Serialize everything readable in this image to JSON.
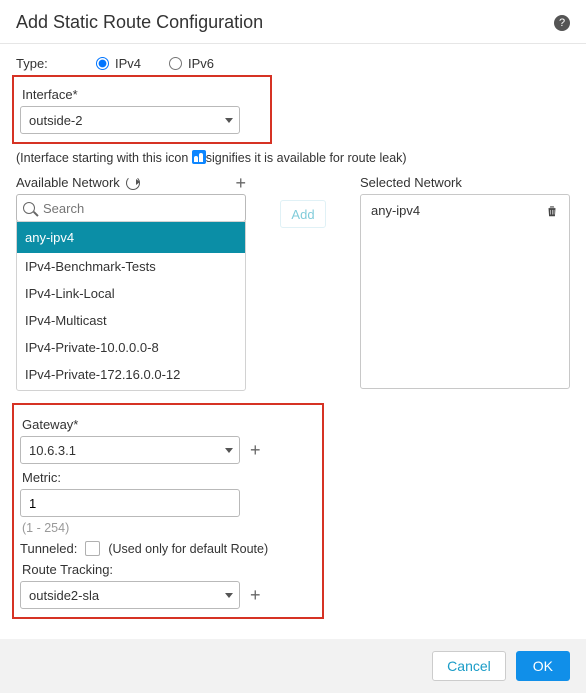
{
  "header": {
    "title": "Add Static Route Configuration"
  },
  "type": {
    "label": "Type:",
    "options": {
      "ipv4": "IPv4",
      "ipv6": "IPv6"
    },
    "selected": "ipv4"
  },
  "interface": {
    "label": "Interface*",
    "value": "outside-2",
    "hint_prefix": "(Interface starting with this icon ",
    "hint_suffix": "signifies it is available for route leak)"
  },
  "available": {
    "label": "Available Network",
    "search_placeholder": "Search",
    "items": [
      "any-ipv4",
      "IPv4-Benchmark-Tests",
      "IPv4-Link-Local",
      "IPv4-Multicast",
      "IPv4-Private-10.0.0.0-8",
      "IPv4-Private-172.16.0.0-12"
    ],
    "selected_index": 0
  },
  "add_button": "Add",
  "selected": {
    "label": "Selected Network",
    "items": [
      "any-ipv4"
    ]
  },
  "gateway": {
    "label": "Gateway*",
    "value": "10.6.3.1"
  },
  "metric": {
    "label": "Metric:",
    "value": "1",
    "range": "(1 - 254)"
  },
  "tunneled": {
    "label": "Tunneled:",
    "note": "(Used only for default Route)"
  },
  "route_tracking": {
    "label": "Route Tracking:",
    "value": "outside2-sla"
  },
  "footer": {
    "cancel": "Cancel",
    "ok": "OK"
  }
}
